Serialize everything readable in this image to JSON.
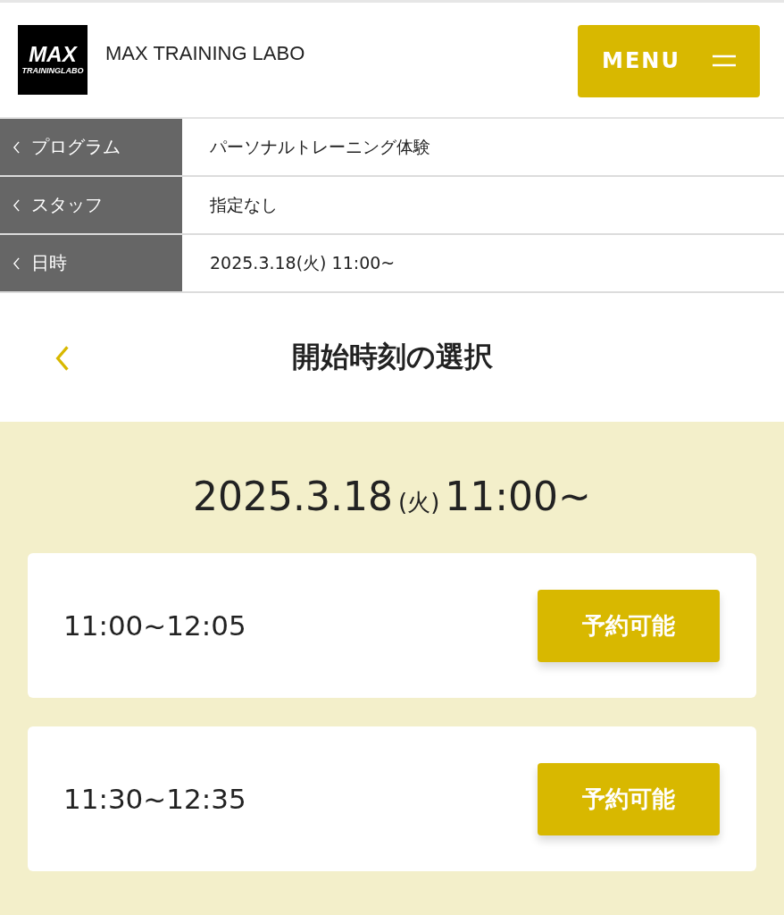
{
  "header": {
    "logo": {
      "line_1": "MAX",
      "line_2": "TRAININGLABO"
    },
    "site_name": "MAX TRAINING LABO",
    "menu_button": {
      "label": "MENU"
    }
  },
  "summary": [
    {
      "label": "プログラム",
      "value": "パーソナルトレーニング体験"
    },
    {
      "label": "スタッフ",
      "value": "指定なし"
    },
    {
      "label": "日時",
      "value": "2025.3.18(火) 11:00~"
    }
  ],
  "section_title": "開始時刻の選択",
  "selected_date": {
    "date": "2025.3.18",
    "weekday": "(火)",
    "time": "11:00~"
  },
  "slots": [
    {
      "time": "11:00~12:05",
      "button": "予約可能"
    },
    {
      "time": "11:30~12:35",
      "button": "予約可能"
    }
  ]
}
